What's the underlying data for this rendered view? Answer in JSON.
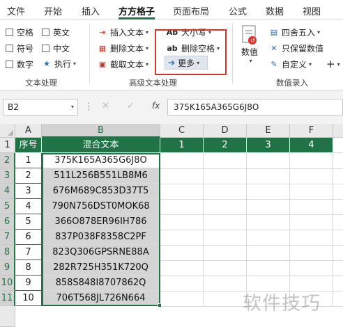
{
  "tabs": [
    "文件",
    "开始",
    "插入",
    "方方格子",
    "页面布局",
    "公式",
    "数据",
    "视图"
  ],
  "active_tab": "方方格子",
  "ribbon": {
    "text_processing": {
      "checkboxes": [
        "空格",
        "英文",
        "符号",
        "中文",
        "数字"
      ],
      "execute": "执行",
      "label": "文本处理"
    },
    "advanced_text": {
      "insert_text": "插入文本",
      "delete_text": "删除文本",
      "extract_text": "截取文本",
      "case": "大小写",
      "delete_space": "删除空格",
      "more": "更多",
      "label": "高级文本处理"
    },
    "numeric_entry": {
      "value": "数值",
      "round": "四舍五入",
      "keep_value": "只保留数值",
      "custom": "自定义",
      "plus": "+",
      "label": "数值录入"
    }
  },
  "formula_bar": {
    "name_box": "B2",
    "value": "375K165A365G6J8O",
    "fx": "fx",
    "cancel": "✕",
    "confirm": "✓"
  },
  "grid": {
    "columns": [
      "A",
      "B",
      "C",
      "D",
      "E",
      "F"
    ],
    "rows": [
      "1",
      "2",
      "3",
      "4",
      "5",
      "6",
      "7",
      "8",
      "9",
      "10",
      "11"
    ],
    "header_row": [
      "序号",
      "混合文本",
      "1",
      "2",
      "3",
      "4"
    ],
    "data": [
      [
        "1",
        "375K165A365G6J8O"
      ],
      [
        "2",
        "511L256B551LB8M6"
      ],
      [
        "3",
        "676M689C853D37T5"
      ],
      [
        "4",
        "790N756DST0MOK68"
      ],
      [
        "5",
        "366O878ER96IH786"
      ],
      [
        "6",
        "837P038F8358C2PF"
      ],
      [
        "7",
        "823Q306GPSRNE88A"
      ],
      [
        "8",
        "282R725H351K720Q"
      ],
      [
        "9",
        "858S848I8707862Q"
      ],
      [
        "10",
        "706T568JL726N664"
      ]
    ]
  },
  "watermark": "软件技巧",
  "colors": {
    "accent": "#217346",
    "highlight_box": "#d9342b"
  }
}
